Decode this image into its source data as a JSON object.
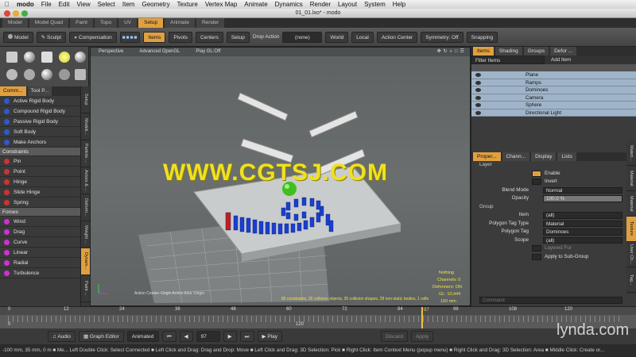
{
  "menubar": {
    "app": "modo",
    "items": [
      "File",
      "Edit",
      "View",
      "Select",
      "Item",
      "Geometry",
      "Texture",
      "Vertex Map",
      "Animate",
      "Dynamics",
      "Render",
      "Layout",
      "System",
      "Help"
    ]
  },
  "window": {
    "title": "01_01.lxo* - modo"
  },
  "layout_tabs": [
    "Model",
    "Model Quad",
    "Paint",
    "Topo",
    "UV",
    "Setup",
    "Animate",
    "Render"
  ],
  "active_layout_tab": "Setup",
  "toolbar": {
    "model": "Model",
    "sculpt": "Sculpt",
    "compensation": "Compensation",
    "items": "Items",
    "pivots": "Pivots",
    "centers": "Centers",
    "setup": "Setup",
    "drop_action_label": "Drop Action",
    "drop_action_value": "(none)",
    "world": "World",
    "local": "Local",
    "action_center": "Action Center",
    "symmetry": "Symmetry: Off",
    "snapping": "Snapping"
  },
  "left_tabs": [
    "Comm...",
    "Tool P..."
  ],
  "left_sections": [
    {
      "title": "",
      "items": [
        "Active Rigid Body",
        "Compound Rigid Body",
        "Passive Rigid Body",
        "Soft Body",
        "Make Anchors"
      ]
    },
    {
      "title": "Constraints",
      "items": [
        "Pin",
        "Point",
        "Hinge",
        "Slide Hinge",
        "Spring"
      ]
    },
    {
      "title": "Forces",
      "items": [
        "Wind",
        "Drag",
        "Curve",
        "Linear",
        "Radial",
        "Turbulence"
      ]
    }
  ],
  "left_vtabs": [
    "Setup",
    "Modeli...",
    "Particle ...",
    "Actors & ...",
    "Deform...",
    "Weight ...",
    "Dynam...",
    "Paint ..."
  ],
  "viewport": {
    "labels": [
      "Perspective",
      "Advanced OpenGL",
      "Play GL:Off"
    ],
    "info": [
      "Nothing",
      "Channels: 0",
      "Deformers: ON",
      "GL: 10,444",
      "160 mm"
    ],
    "bottom_left": "Action Center: Origin   Action Axis: Origin",
    "bottom_center": "86 constraints, 35 collision objects, 35 collision shapes, 28 non-static bodies, 1 rafts"
  },
  "right_top_tabs": [
    "Items",
    "Shading",
    "Groups",
    "Defor ..."
  ],
  "item_list": {
    "filter": "Filter Items",
    "add": "Add Item",
    "rows": [
      "Plane",
      "Ramps",
      "Dominoes",
      "Camera",
      "Sphere",
      "Directional Light"
    ]
  },
  "props_tabs": [
    "Proper...",
    "Chann...",
    "Display",
    "Lists"
  ],
  "props": {
    "layer_title": "Layer",
    "enable": "Enable",
    "invert": "Invert",
    "blend_mode_label": "Blend Mode",
    "blend_mode": "Normal",
    "opacity_label": "Opacity",
    "opacity": "100.0 %",
    "group_title": "Group",
    "item_label": "Item",
    "item": "(all)",
    "ptt_label": "Polygon Tag Type",
    "ptt": "Material",
    "ptag_label": "Polygon Tag",
    "ptag": "Dominoes",
    "scope_label": "Scope",
    "scope": "(all)",
    "layered_fur": "Layered Fur",
    "apply_sub": "Apply to Sub-Group",
    "command": "Command"
  },
  "right_vtabs": [
    "Materi...",
    "Material",
    "Material",
    "Texture",
    "User Ch...",
    "Tag..."
  ],
  "timeline": {
    "ticks": [
      "0",
      "12",
      "24",
      "36",
      "48",
      "60",
      "72",
      "84",
      "96",
      "108",
      "120"
    ],
    "bottom_ticks": [
      "0",
      "120"
    ],
    "playhead": "97"
  },
  "transport": {
    "audio": "Audio",
    "graph_editor": "Graph Editor",
    "animated": "Animated",
    "frame": "97",
    "play": "Play",
    "discard": "Discard",
    "apply": "Apply"
  },
  "status": "-100 mm, 35 mm, 0 m  ■ Me...  Left Double Click: Select Connected  ■ Left Click and Drag: Drag and Drop: Move  ■ Left Click and Drag: 3D Selection: Pick  ■ Right Click: Item Context Menu (popup menu)  ■ Right Click and Drag: 3D Selection: Area  ■ Middle Click: Create or...",
  "watermark": "WWW.CGTSJ.COM",
  "lynda": "lynda.com",
  "colors": {
    "accent": "#e0a040",
    "domino_blue": "#1a3fd0",
    "sphere_green": "#3fc020",
    "watermark": "#f0e020"
  }
}
